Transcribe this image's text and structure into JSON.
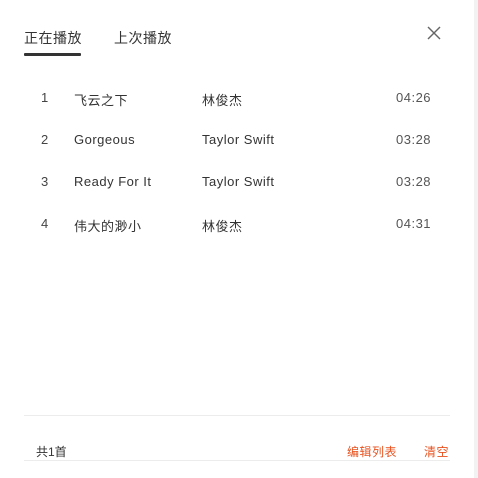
{
  "tabs": [
    {
      "label": "正在播放",
      "active": true
    },
    {
      "label": "上次播放",
      "active": false
    }
  ],
  "close_icon": "close-icon",
  "tracks": [
    {
      "index": "1",
      "title": "飞云之下",
      "artist": "林俊杰",
      "duration": "04:26"
    },
    {
      "index": "2",
      "title": "Gorgeous",
      "artist": "Taylor Swift",
      "duration": "03:28"
    },
    {
      "index": "3",
      "title": "Ready For It",
      "artist": "Taylor Swift",
      "duration": "03:28"
    },
    {
      "index": "4",
      "title": "伟大的渺小",
      "artist": "林俊杰",
      "duration": "04:31"
    }
  ],
  "footer": {
    "count": "共1首",
    "edit_label": "编辑列表",
    "clear_label": "清空"
  },
  "colors": {
    "accent": "#e8521f",
    "text": "#333333"
  }
}
